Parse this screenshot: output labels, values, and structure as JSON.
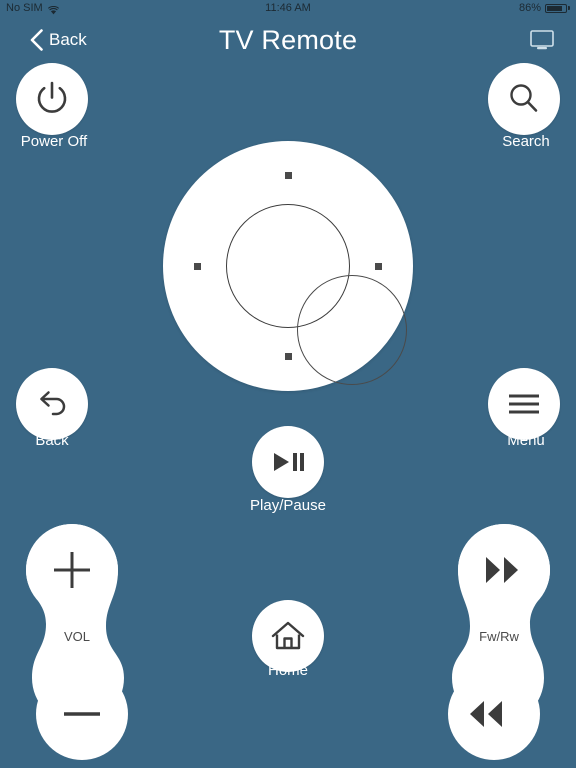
{
  "status_bar": {
    "carrier": "No SIM",
    "wifi_icon": "wifi-icon",
    "time": "11:46 AM",
    "battery_percent": "86%",
    "battery_level": 86,
    "battery_icon": "battery-icon"
  },
  "nav_bar": {
    "back_label": "Back",
    "back_icon": "chevron-left-icon",
    "title": "TV Remote",
    "device_icon": "tv-monitor-icon"
  },
  "colors": {
    "background": "#3a6785",
    "button_face": "#ffffff",
    "icon_dark": "#3c3c3c",
    "label_white": "#ffffff",
    "status_text": "#1c2a33"
  },
  "buttons": {
    "power": {
      "label": "Power Off",
      "icon": "power-icon"
    },
    "search": {
      "label": "Search",
      "icon": "search-icon"
    },
    "back": {
      "label": "Back",
      "icon": "undo-arrow-icon"
    },
    "menu": {
      "label": "Menu",
      "icon": "hamburger-menu-icon"
    },
    "play_pause": {
      "label": "Play/Pause",
      "icon": "play-pause-icon"
    },
    "home": {
      "label": "Home",
      "icon": "home-icon"
    }
  },
  "dpad": {
    "up_icon": "dpad-up-dot",
    "down_icon": "dpad-down-dot",
    "left_icon": "dpad-left-dot",
    "right_icon": "dpad-right-dot",
    "ok_icon": "dpad-ok-ring"
  },
  "rockers": {
    "volume": {
      "label": "VOL",
      "up_icon": "plus-icon",
      "down_icon": "minus-icon"
    },
    "transport": {
      "label": "Fw/Rw",
      "up_icon": "fast-forward-icon",
      "down_icon": "rewind-icon"
    }
  }
}
